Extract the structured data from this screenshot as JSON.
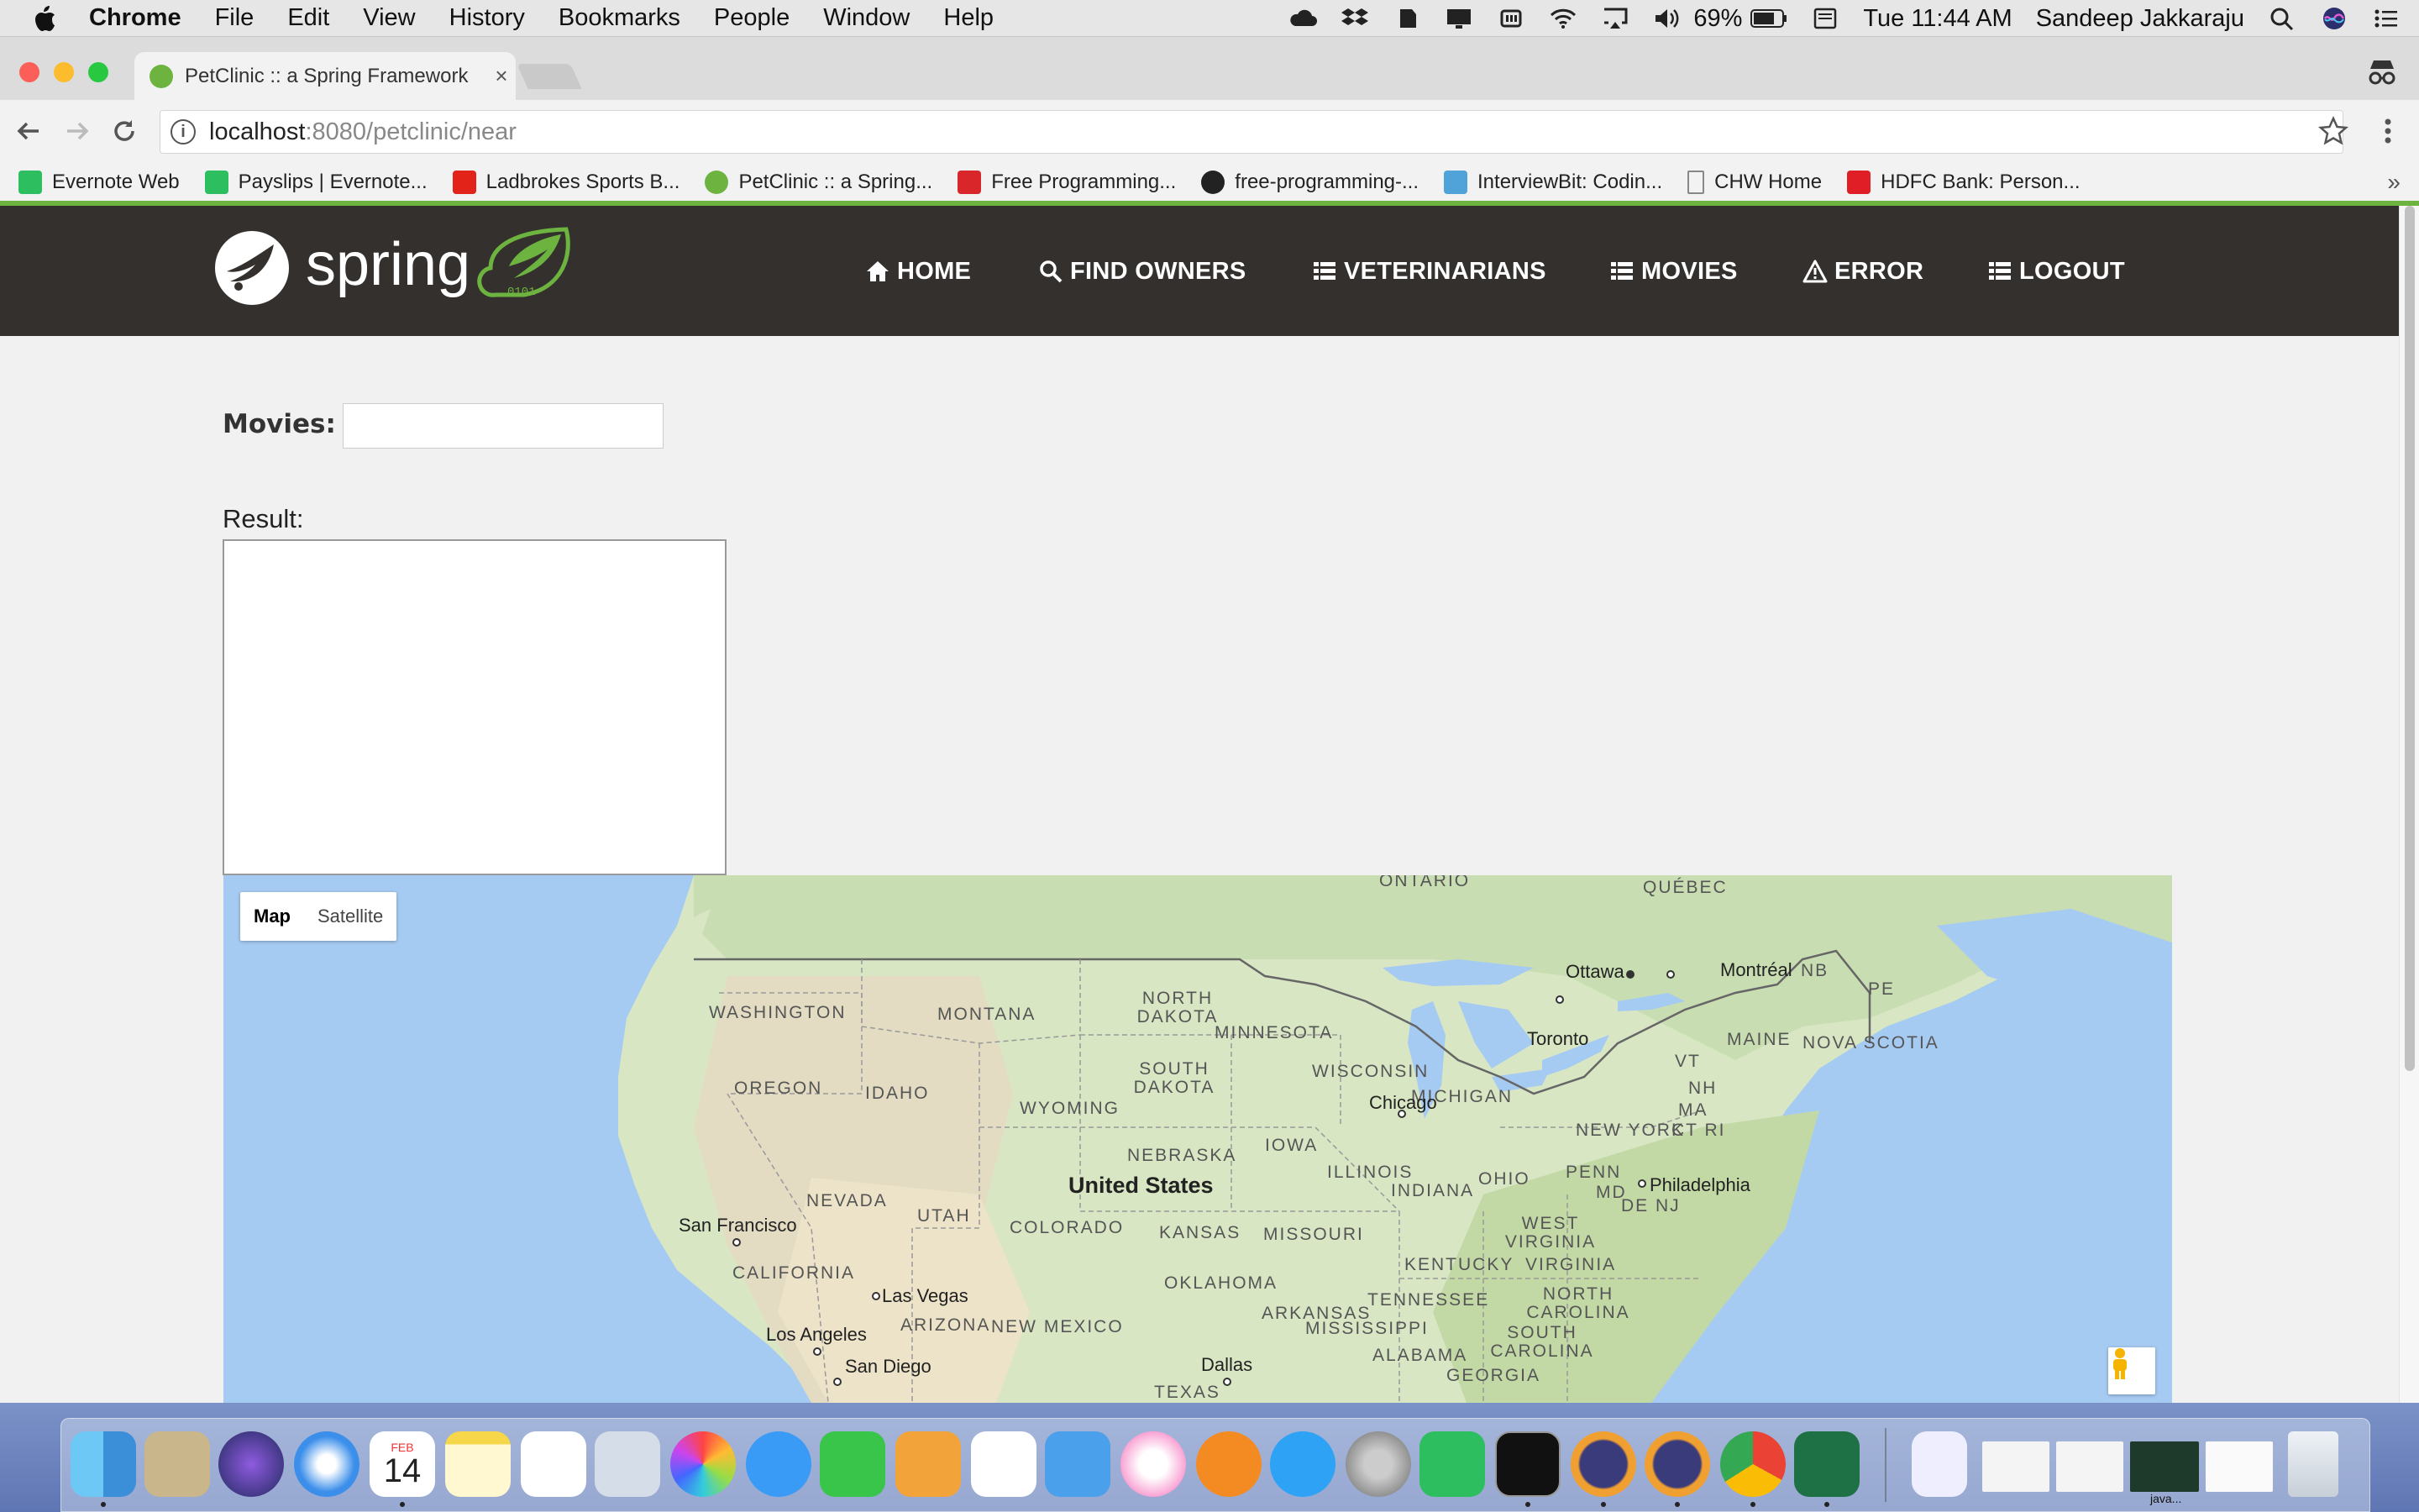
{
  "menubar": {
    "app": "Chrome",
    "items": [
      "File",
      "Edit",
      "View",
      "History",
      "Bookmarks",
      "People",
      "Window",
      "Help"
    ],
    "battery": "69%",
    "clock": "Tue 11:44 AM",
    "user": "Sandeep Jakkaraju"
  },
  "browser": {
    "tab_title": "PetClinic :: a Spring Framework",
    "tab_close": "×",
    "url_host": "localhost",
    "url_path": ":8080/petclinic/near",
    "info_icon": "i",
    "bookmarks": [
      {
        "label": "Evernote Web",
        "color": "#2dbe60"
      },
      {
        "label": "Payslips | Evernote...",
        "color": "#2dbe60"
      },
      {
        "label": "Ladbrokes Sports B...",
        "color": "#e2231a"
      },
      {
        "label": "PetClinic :: a Spring...",
        "color": "#6db33f"
      },
      {
        "label": "Free Programming...",
        "color": "#d9262a"
      },
      {
        "label": "free-programming-...",
        "color": "#222222"
      },
      {
        "label": "InterviewBit: Codin...",
        "color": "#4fa3d9"
      },
      {
        "label": "CHW Home",
        "color": "#aaaaaa"
      },
      {
        "label": "HDFC Bank: Person...",
        "color": "#e01e26"
      }
    ],
    "bookmarks_more": "»",
    "accent": "#6db33f"
  },
  "nav": {
    "brand": "spring",
    "brand_sub": "0101",
    "links": [
      "HOME",
      "FIND OWNERS",
      "VETERINARIANS",
      "MOVIES",
      "ERROR",
      "LOGOUT"
    ]
  },
  "form": {
    "movies_label": "Movies:",
    "movies_value": "",
    "result_label": "Result:"
  },
  "map": {
    "type_map": "Map",
    "type_satellite": "Satellite",
    "country": "United States",
    "regions": [
      "ONTARIO",
      "QUÉBEC",
      "NORTH DAKOTA",
      "WASHINGTON",
      "MONTANA",
      "MINNESOTA",
      "SOUTH DAKOTA",
      "WISCONSIN",
      "OREGON",
      "IDAHO",
      "WYOMING",
      "MICHIGAN",
      "NEBRASKA",
      "IOWA",
      "ILLINOIS",
      "NEVADA",
      "UTAH",
      "COLORADO",
      "KANSAS",
      "MISSOURI",
      "INDIANA",
      "OHIO",
      "PENN",
      "NEW YORK",
      "CALIFORNIA",
      "OKLAHOMA",
      "KENTUCKY",
      "WEST VIRGINIA",
      "VIRGINIA",
      "TENNESSEE",
      "NORTH CAROLINA",
      "ARIZONA",
      "NEW MEXICO",
      "ARKANSAS",
      "SOUTH CAROLINA",
      "MISSISSIPPI",
      "ALABAMA",
      "GEORGIA",
      "TEXAS",
      "NB",
      "PE",
      "MAINE",
      "NOVA SCOTIA",
      "VT",
      "NH",
      "MA",
      "CT RI",
      "MD",
      "DE NJ"
    ],
    "cities": [
      "Ottawa",
      "Montréal",
      "Toronto",
      "Chicago",
      "Philadelphia",
      "San Francisco",
      "Las Vegas",
      "Los Angeles",
      "San Diego",
      "Dallas"
    ]
  },
  "dock": {
    "calendar_month": "FEB",
    "calendar_day": "14",
    "apps": [
      "finder",
      "preview",
      "siri",
      "safari",
      "calendar",
      "notes",
      "reminders",
      "image-capture",
      "photos",
      "messages",
      "facetime",
      "pages",
      "numbers",
      "keynote",
      "itunes",
      "ibooks",
      "app-store",
      "system-preferences",
      "evernote",
      "terminal",
      "eclipse",
      "eclipse",
      "chrome",
      "excel"
    ],
    "minimized_label": "java..."
  }
}
